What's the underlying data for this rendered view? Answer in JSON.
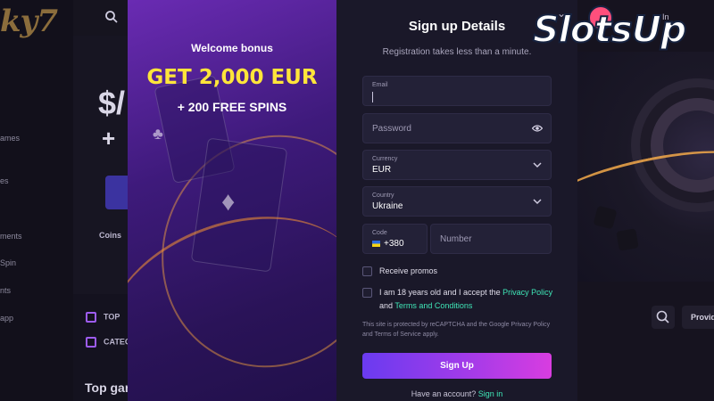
{
  "background": {
    "logo": "ky7",
    "nav_items": [
      "ames",
      "es",
      "ments",
      "Spin",
      "nts",
      "app"
    ],
    "hero": {
      "line1": "$/",
      "line2": "+"
    },
    "coins_label": "Coins",
    "categories": [
      "TOP",
      "CATEG"
    ],
    "section_title": "Top gar",
    "right_login": "In",
    "provider_button": "Provid"
  },
  "modal": {
    "promo": {
      "welcome": "Welcome bonus",
      "headline": "GET 2,000 EUR",
      "subline": "+ 200 FREE SPINS"
    },
    "form": {
      "title": "Sign up Details",
      "subtitle": "Registration takes less than a minute.",
      "email": {
        "label": "Email",
        "value": ""
      },
      "password": {
        "placeholder": "Password"
      },
      "currency": {
        "label": "Currency",
        "value": "EUR"
      },
      "country": {
        "label": "Country",
        "value": "Ukraine"
      },
      "code": {
        "label": "Code",
        "value": "+380"
      },
      "number": {
        "placeholder": "Number"
      },
      "receive_promos": "Receive promos",
      "age_terms_pre": "I am 18 years old and I accept the ",
      "privacy_policy": "Privacy Policy",
      "and_text": "and ",
      "terms_link": "Terms and Conditions",
      "captcha_note": "This site is protected by reCAPTCHA and the Google Privacy Policy and Terms of Service apply.",
      "signup_button": "Sign Up",
      "have_account": "Have an account?",
      "signin_link": "Sign in"
    }
  },
  "watermark": {
    "brand": "SlotsUp"
  },
  "colors": {
    "accent_link": "#3fe6b7",
    "headline_yellow": "#ffe53a",
    "button_start": "#6a3bf0",
    "button_end": "#d83de0"
  }
}
